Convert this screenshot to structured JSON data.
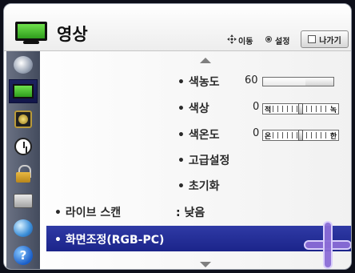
{
  "header": {
    "title": "영상",
    "hints": {
      "move": "이동",
      "set": "설정"
    },
    "exit_label": "나가기"
  },
  "sidebar": {
    "items": [
      {
        "icon": "satellite-icon"
      },
      {
        "icon": "tv-icon",
        "selected": true
      },
      {
        "icon": "speaker-icon"
      },
      {
        "icon": "clock-icon"
      },
      {
        "icon": "lock-icon"
      },
      {
        "icon": "briefcase-icon"
      },
      {
        "icon": "globe-icon"
      },
      {
        "icon": "help-icon",
        "glyph": "?"
      }
    ]
  },
  "menu": {
    "rows": [
      {
        "label": "• 색농도",
        "value": "60",
        "control": "slider",
        "level_fraction": 0.6
      },
      {
        "label": "• 색상",
        "value": "0",
        "control": "balance",
        "left_end": "적",
        "right_end": "녹"
      },
      {
        "label": "• 색온도",
        "value": "0",
        "control": "balance",
        "left_end": "온",
        "right_end": "한"
      },
      {
        "label": "• 고급설정"
      },
      {
        "label": "• 초기화"
      },
      {
        "label": "• 라이브 스캔",
        "value": ": 낮음"
      },
      {
        "label": "• 화면조정(RGB-PC)",
        "selected": true
      }
    ]
  },
  "colors": {
    "selected_bg": "#2233a0",
    "sidebar_bg": "#555d70",
    "accent_purple": "#8a6cd6"
  }
}
